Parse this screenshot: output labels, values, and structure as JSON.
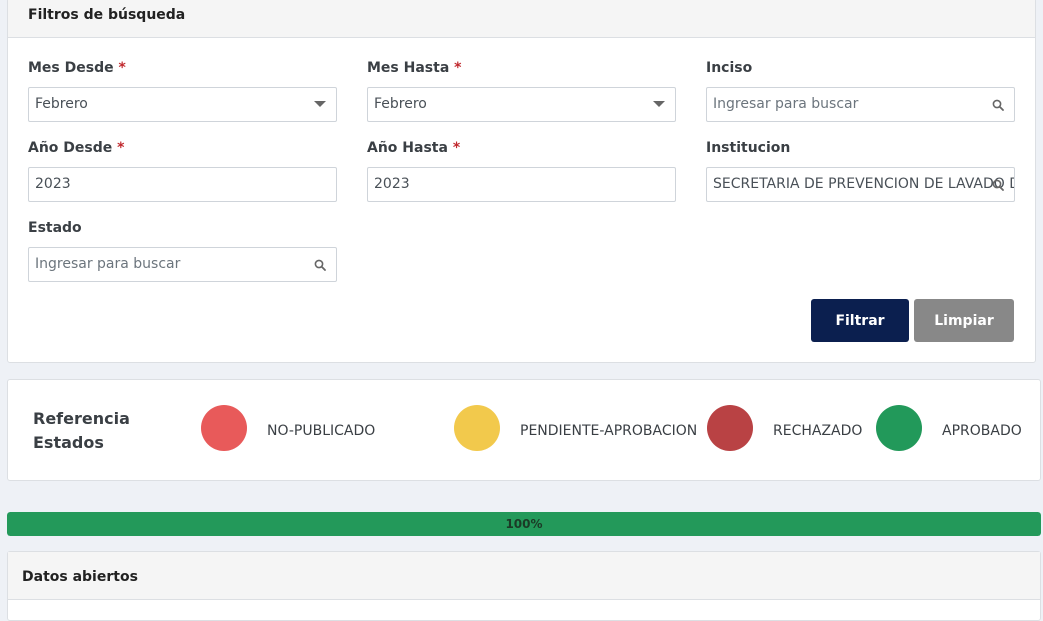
{
  "filters": {
    "header": "Filtros de búsqueda",
    "required_mark": "*",
    "mes_desde": {
      "label": "Mes Desde",
      "value": "Febrero"
    },
    "mes_hasta": {
      "label": "Mes Hasta",
      "value": "Febrero"
    },
    "inciso": {
      "label": "Inciso",
      "placeholder": "Ingresar para buscar"
    },
    "anio_desde": {
      "label": "Año Desde",
      "value": "2023"
    },
    "anio_hasta": {
      "label": "Año Hasta",
      "value": "2023"
    },
    "institucion": {
      "label": "Institucion",
      "value": "SECRETARIA DE PREVENCION DE LAVADO DE"
    },
    "estado": {
      "label": "Estado",
      "placeholder": "Ingresar para buscar"
    },
    "filtrar_label": "Filtrar",
    "limpiar_label": "Limpiar"
  },
  "reference": {
    "title": "Referencia Estados",
    "states": [
      {
        "label": "NO-PUBLICADO",
        "color": "#e85a5a"
      },
      {
        "label": "PENDIENTE-APROBACION",
        "color": "#f2c94c"
      },
      {
        "label": "RECHAZADO",
        "color": "#b94244"
      },
      {
        "label": "APROBADO",
        "color": "#22995a"
      }
    ]
  },
  "progress": {
    "label": "100%",
    "percent": 100
  },
  "datos": {
    "header": "Datos abiertos"
  },
  "icons": {
    "dropdown": "chevron-down-icon",
    "search": "search-icon"
  }
}
